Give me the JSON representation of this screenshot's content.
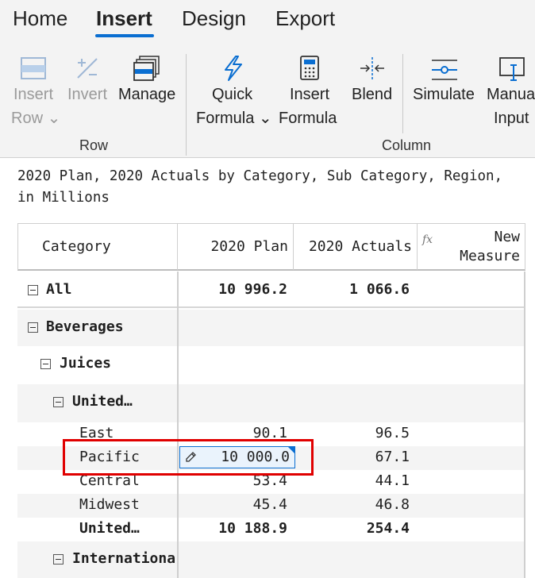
{
  "tabs": [
    "Home",
    "Insert",
    "Design",
    "Export"
  ],
  "ribbon": {
    "row_group": {
      "label": "Row",
      "insert_row": {
        "line1": "Insert",
        "line2": "Row"
      },
      "invert": {
        "line1": "Invert"
      },
      "manage": {
        "line1": "Manage"
      }
    },
    "column_group": {
      "label": "Column",
      "quick_formula": {
        "line1": "Quick",
        "line2": "Formula"
      },
      "insert_formula": {
        "line1": "Insert",
        "line2": "Formula"
      },
      "blend": {
        "line1": "Blend"
      },
      "simulate": {
        "line1": "Simulate"
      },
      "manual_input": {
        "line1": "Manua",
        "line2": "Input"
      }
    }
  },
  "description": {
    "line1": "2020 Plan, 2020 Actuals by Category, Sub Category, Region,",
    "line2": "in Millions"
  },
  "grid": {
    "headers": {
      "category": "Category",
      "plan": "2020 Plan",
      "actuals": "2020 Actuals",
      "fx": "fx",
      "new_measure_1": "New",
      "new_measure_2": "Measure"
    },
    "rows": [
      {
        "label": "All",
        "plan": "10 996.2",
        "actuals": "1 066.6"
      },
      {
        "label": "Beverages",
        "plan": "",
        "actuals": ""
      },
      {
        "label": "Juices",
        "plan": "",
        "actuals": ""
      },
      {
        "label": "United…",
        "plan": "",
        "actuals": ""
      },
      {
        "label": "East",
        "plan": "90.1",
        "actuals": "96.5"
      },
      {
        "label": "Pacific",
        "plan": "10 000.0",
        "actuals": "67.1"
      },
      {
        "label": "Central",
        "plan": "53.4",
        "actuals": "44.1"
      },
      {
        "label": "Midwest",
        "plan": "45.4",
        "actuals": "46.8"
      },
      {
        "label": "United…",
        "plan": "10 188.9",
        "actuals": "254.4"
      },
      {
        "label": "Internationa",
        "plan": "",
        "actuals": ""
      }
    ]
  },
  "colors": {
    "accent": "#0a6ed1",
    "highlight_border": "#e00000"
  }
}
